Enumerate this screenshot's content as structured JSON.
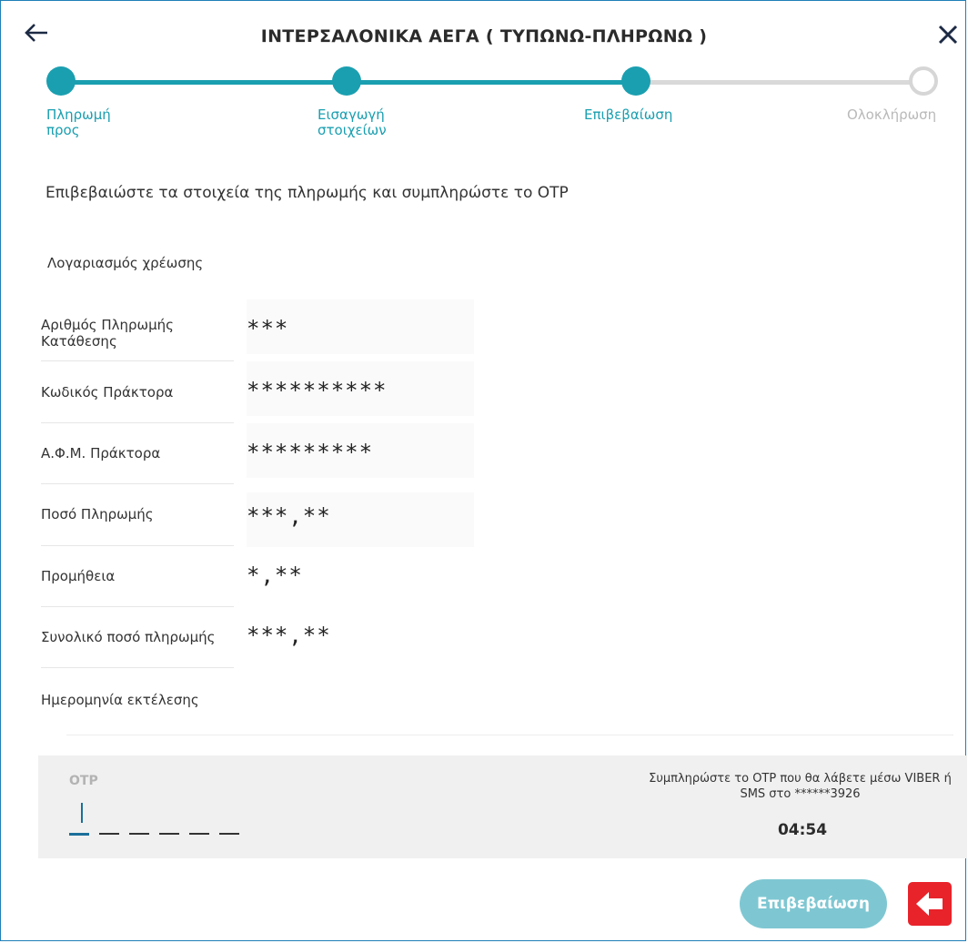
{
  "header": {
    "title": "ΙΝΤΕΡΣΑΛΟΝΙΚΑ ΑΕΓΑ ( ΤΥΠΩΝΩ-ΠΛΗΡΩΝΩ )",
    "back_icon": "arrow-left-icon",
    "close_icon": "close-icon"
  },
  "stepper": {
    "steps": [
      {
        "label_line1": "Πληρωμή",
        "label_line2": "προς",
        "state": "done"
      },
      {
        "label_line1": "Εισαγωγή",
        "label_line2": "στοιχείων",
        "state": "done"
      },
      {
        "label_line1": "Επιβεβαίωση",
        "label_line2": "",
        "state": "current"
      },
      {
        "label_line1": "Ολοκλήρωση",
        "label_line2": "",
        "state": "pending"
      }
    ]
  },
  "intro_text": "Επιβεβαιώστε τα στοιχεία της πληρωμής και συμπληρώστε το OTP",
  "debit_account_label": "Λογαριασμός χρέωσης",
  "details": [
    {
      "label_line1": "Αριθμός Πληρωμής",
      "label_line2": "Κατάθεσης",
      "value": "***"
    },
    {
      "label_line1": "Κωδικός Πράκτορα",
      "label_line2": "",
      "value": "**********"
    },
    {
      "label_line1": "Α.Φ.Μ. Πράκτορα",
      "label_line2": "",
      "value": "*********"
    },
    {
      "label_line1": "Ποσό Πληρωμής",
      "label_line2": "",
      "value": "***,**"
    },
    {
      "label_line1": "Προμήθεια",
      "label_line2": "",
      "value": "*,**"
    },
    {
      "label_line1": "Συνολικό ποσό πληρωμής",
      "label_line2": "",
      "value": "***,**"
    }
  ],
  "execution_date_label": "Ημερομηνία εκτέλεσης",
  "otp": {
    "title": "OTP",
    "hint_line1": "Συμπληρώστε το OTP που θα λάβετε μέσω VIBER ή",
    "hint_line2": "SMS στο ******3926",
    "timer": "04:54",
    "slots": 6
  },
  "confirm_button_label": "Επιβεβαίωση",
  "colors": {
    "accent": "#1a9fb0",
    "pending": "#d6d6d6",
    "button": "#7ec7d2",
    "badge": "#e8232a"
  }
}
